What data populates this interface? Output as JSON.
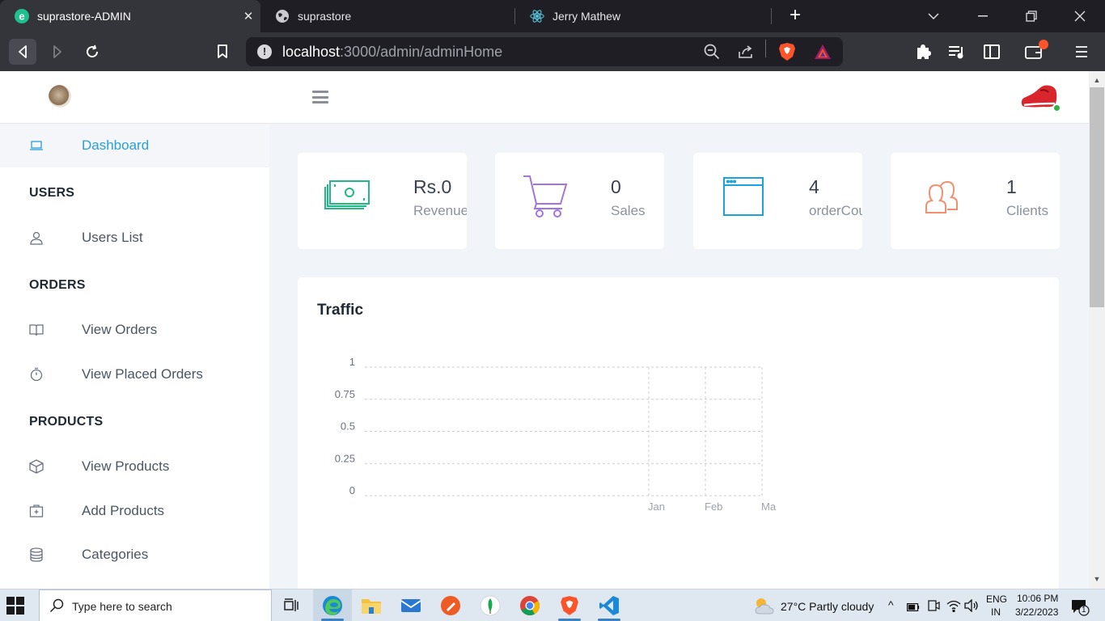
{
  "browser": {
    "tabs": [
      {
        "title": "suprastore-ADMIN",
        "active": true
      },
      {
        "title": "suprastore",
        "active": false
      },
      {
        "title": "Jerry Mathew",
        "active": false
      }
    ],
    "url_host": "localhost",
    "url_path": ":3000/admin/adminHome"
  },
  "sidebar": {
    "dashboard": "Dashboard",
    "users_heading": "USERS",
    "users_list": "Users List",
    "orders_heading": "ORDERS",
    "view_orders": "View Orders",
    "view_placed_orders": "View Placed Orders",
    "products_heading": "PRODUCTS",
    "view_products": "View Products",
    "add_products": "Add Products",
    "categories": "Categories"
  },
  "stats": [
    {
      "value": "Rs.0",
      "label": "Revenue",
      "icon": "cash-icon",
      "color": "#20b883"
    },
    {
      "value": "0",
      "label": "Sales",
      "icon": "cart-icon",
      "color": "#a374e0"
    },
    {
      "value": "4",
      "label": "orderCount",
      "icon": "browser-window-icon",
      "color": "#1ea2dc"
    },
    {
      "value": "1",
      "label": "Clients",
      "icon": "users-icon",
      "color": "#f0906f"
    }
  ],
  "traffic": {
    "title": "Traffic"
  },
  "chart_data": {
    "type": "line",
    "title": "Traffic",
    "categories": [
      "Jan",
      "Feb",
      "Ma"
    ],
    "y_ticks": [
      "1",
      "0.75",
      "0.5",
      "0.25",
      "0"
    ],
    "ylim": [
      0,
      1
    ],
    "grid": true,
    "series": []
  },
  "taskbar": {
    "search_placeholder": "Type here to search",
    "weather": "27°C  Partly cloudy",
    "lang_top": "ENG",
    "lang_bottom": "IN",
    "time": "10:06 PM",
    "date": "3/22/2023",
    "notifications": "1"
  }
}
